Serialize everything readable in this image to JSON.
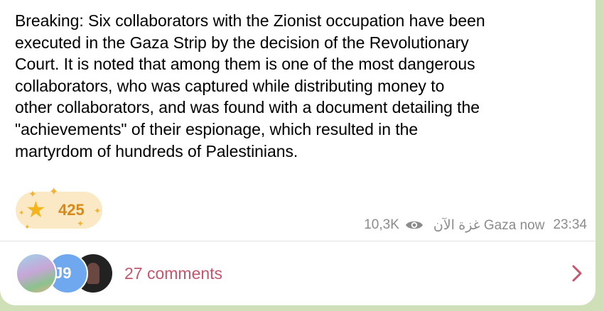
{
  "message": {
    "text": "Breaking: Six collaborators with the Zionist occupation have been\nexecuted in the Gaza Strip by the decision of the Revolutionary\nCourt. It is noted that among them is one of the most dangerous\ncollaborators, who was captured while distributing money to\nother collaborators, and was found with a document detailing the\n\"achievements\" of their espionage, which resulted in the\nmartyrdom of hundreds of Palestinians."
  },
  "reaction": {
    "icon": "star-icon",
    "count": "425"
  },
  "meta": {
    "views": "10,3K",
    "author": "غزة الآن Gaza now",
    "time": "23:34"
  },
  "comments": {
    "avatar_initials": "J9",
    "label": "27 comments"
  },
  "colors": {
    "accent": "#c5566d",
    "reaction_bg": "#fbe9c6",
    "reaction_text": "#d78a1a",
    "meta_text": "#8c8c8c",
    "background": "#cfe0b8"
  }
}
